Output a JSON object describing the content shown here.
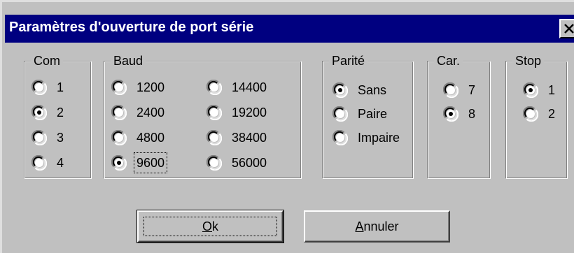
{
  "window": {
    "title": "Paramètres d'ouverture de port série",
    "close_label": "×"
  },
  "groups": {
    "com": {
      "legend": "Com",
      "options": [
        "1",
        "2",
        "3",
        "4"
      ],
      "selected": "2"
    },
    "baud": {
      "legend": "Baud",
      "options": [
        "1200",
        "2400",
        "4800",
        "9600",
        "14400",
        "19200",
        "38400",
        "56000"
      ],
      "selected": "9600",
      "focused": "9600"
    },
    "parity": {
      "legend": "Parité",
      "options": [
        "Sans",
        "Paire",
        "Impaire"
      ],
      "selected": "Sans"
    },
    "car": {
      "legend": "Car.",
      "options": [
        "7",
        "8"
      ],
      "selected": "8"
    },
    "stop": {
      "legend": "Stop",
      "options": [
        "1",
        "2"
      ],
      "selected": "1"
    }
  },
  "buttons": {
    "ok": {
      "mnemonic": "O",
      "rest": "k"
    },
    "cancel": {
      "mnemonic": "A",
      "rest": "nnuler"
    }
  },
  "colors": {
    "face": "#c0c0c0",
    "title_bar": "#000080",
    "title_text": "#ffffff"
  },
  "icons": {
    "radio": "radio-button-icon",
    "close": "close-icon"
  }
}
